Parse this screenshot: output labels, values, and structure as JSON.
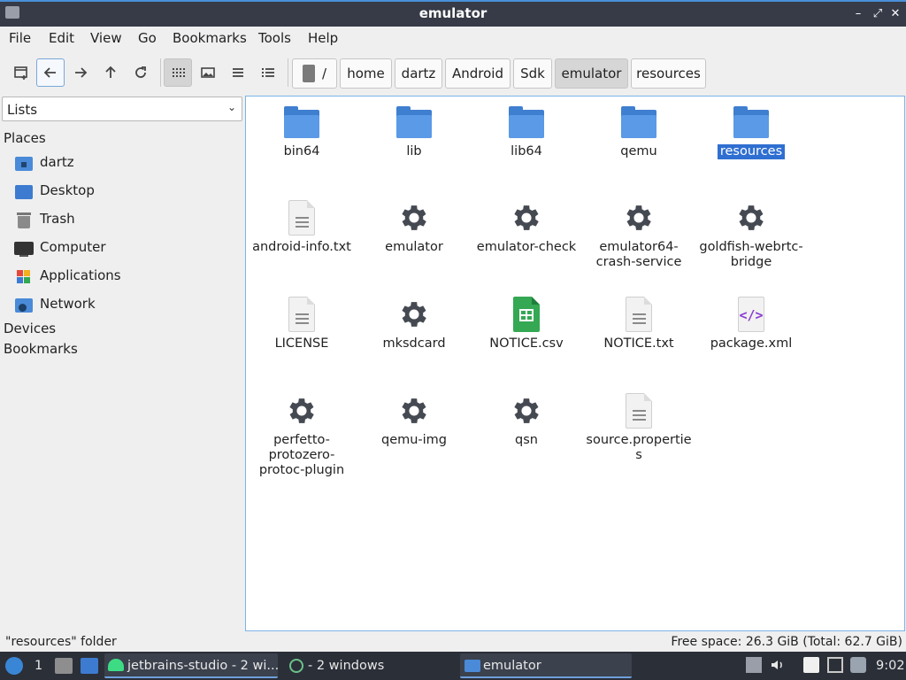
{
  "window": {
    "title": "emulator"
  },
  "menu": [
    "File",
    "Edit",
    "View",
    "Go",
    "Bookmarks",
    "Tools",
    "Help"
  ],
  "breadcrumb": {
    "root": "/",
    "parts": [
      "home",
      "dartz",
      "Android",
      "Sdk",
      "emulator",
      "resources"
    ],
    "current_index": 4
  },
  "sidepane": {
    "mode": "Lists",
    "places_heading": "Places",
    "places": [
      "dartz",
      "Desktop",
      "Trash",
      "Computer",
      "Applications",
      "Network"
    ],
    "devices_heading": "Devices",
    "bookmarks_heading": "Bookmarks"
  },
  "files": [
    {
      "name": "bin64",
      "type": "folder"
    },
    {
      "name": "lib",
      "type": "folder"
    },
    {
      "name": "lib64",
      "type": "folder"
    },
    {
      "name": "qemu",
      "type": "folder"
    },
    {
      "name": "resources",
      "type": "folder",
      "selected": true
    },
    {
      "name": "android-info.txt",
      "type": "text"
    },
    {
      "name": "emulator",
      "type": "executable"
    },
    {
      "name": "emulator-check",
      "type": "executable"
    },
    {
      "name": "emulator64-crash-service",
      "type": "executable"
    },
    {
      "name": "goldfish-webrtc-bridge",
      "type": "executable"
    },
    {
      "name": "LICENSE",
      "type": "text"
    },
    {
      "name": "mksdcard",
      "type": "executable"
    },
    {
      "name": "NOTICE.csv",
      "type": "spreadsheet"
    },
    {
      "name": "NOTICE.txt",
      "type": "text"
    },
    {
      "name": "package.xml",
      "type": "xml"
    },
    {
      "name": "perfetto-protozero-protoc-plugin",
      "type": "executable"
    },
    {
      "name": "qemu-img",
      "type": "executable"
    },
    {
      "name": "qsn",
      "type": "executable"
    },
    {
      "name": "source.properties",
      "type": "text"
    }
  ],
  "status": {
    "selection": "\"resources\" folder",
    "free_space": "Free space: 26.3 GiB (Total: 62.7 GiB)"
  },
  "taskbar": {
    "workspace": "1",
    "tasks": [
      "jetbrains-studio - 2 wi...",
      "- 2 windows",
      "emulator"
    ],
    "clock": "9:02"
  },
  "colors": {
    "accent": "#2f6fd1",
    "folder": "#5a9ae6",
    "titlebar": "#363b47",
    "taskbar": "#2b2f38"
  }
}
